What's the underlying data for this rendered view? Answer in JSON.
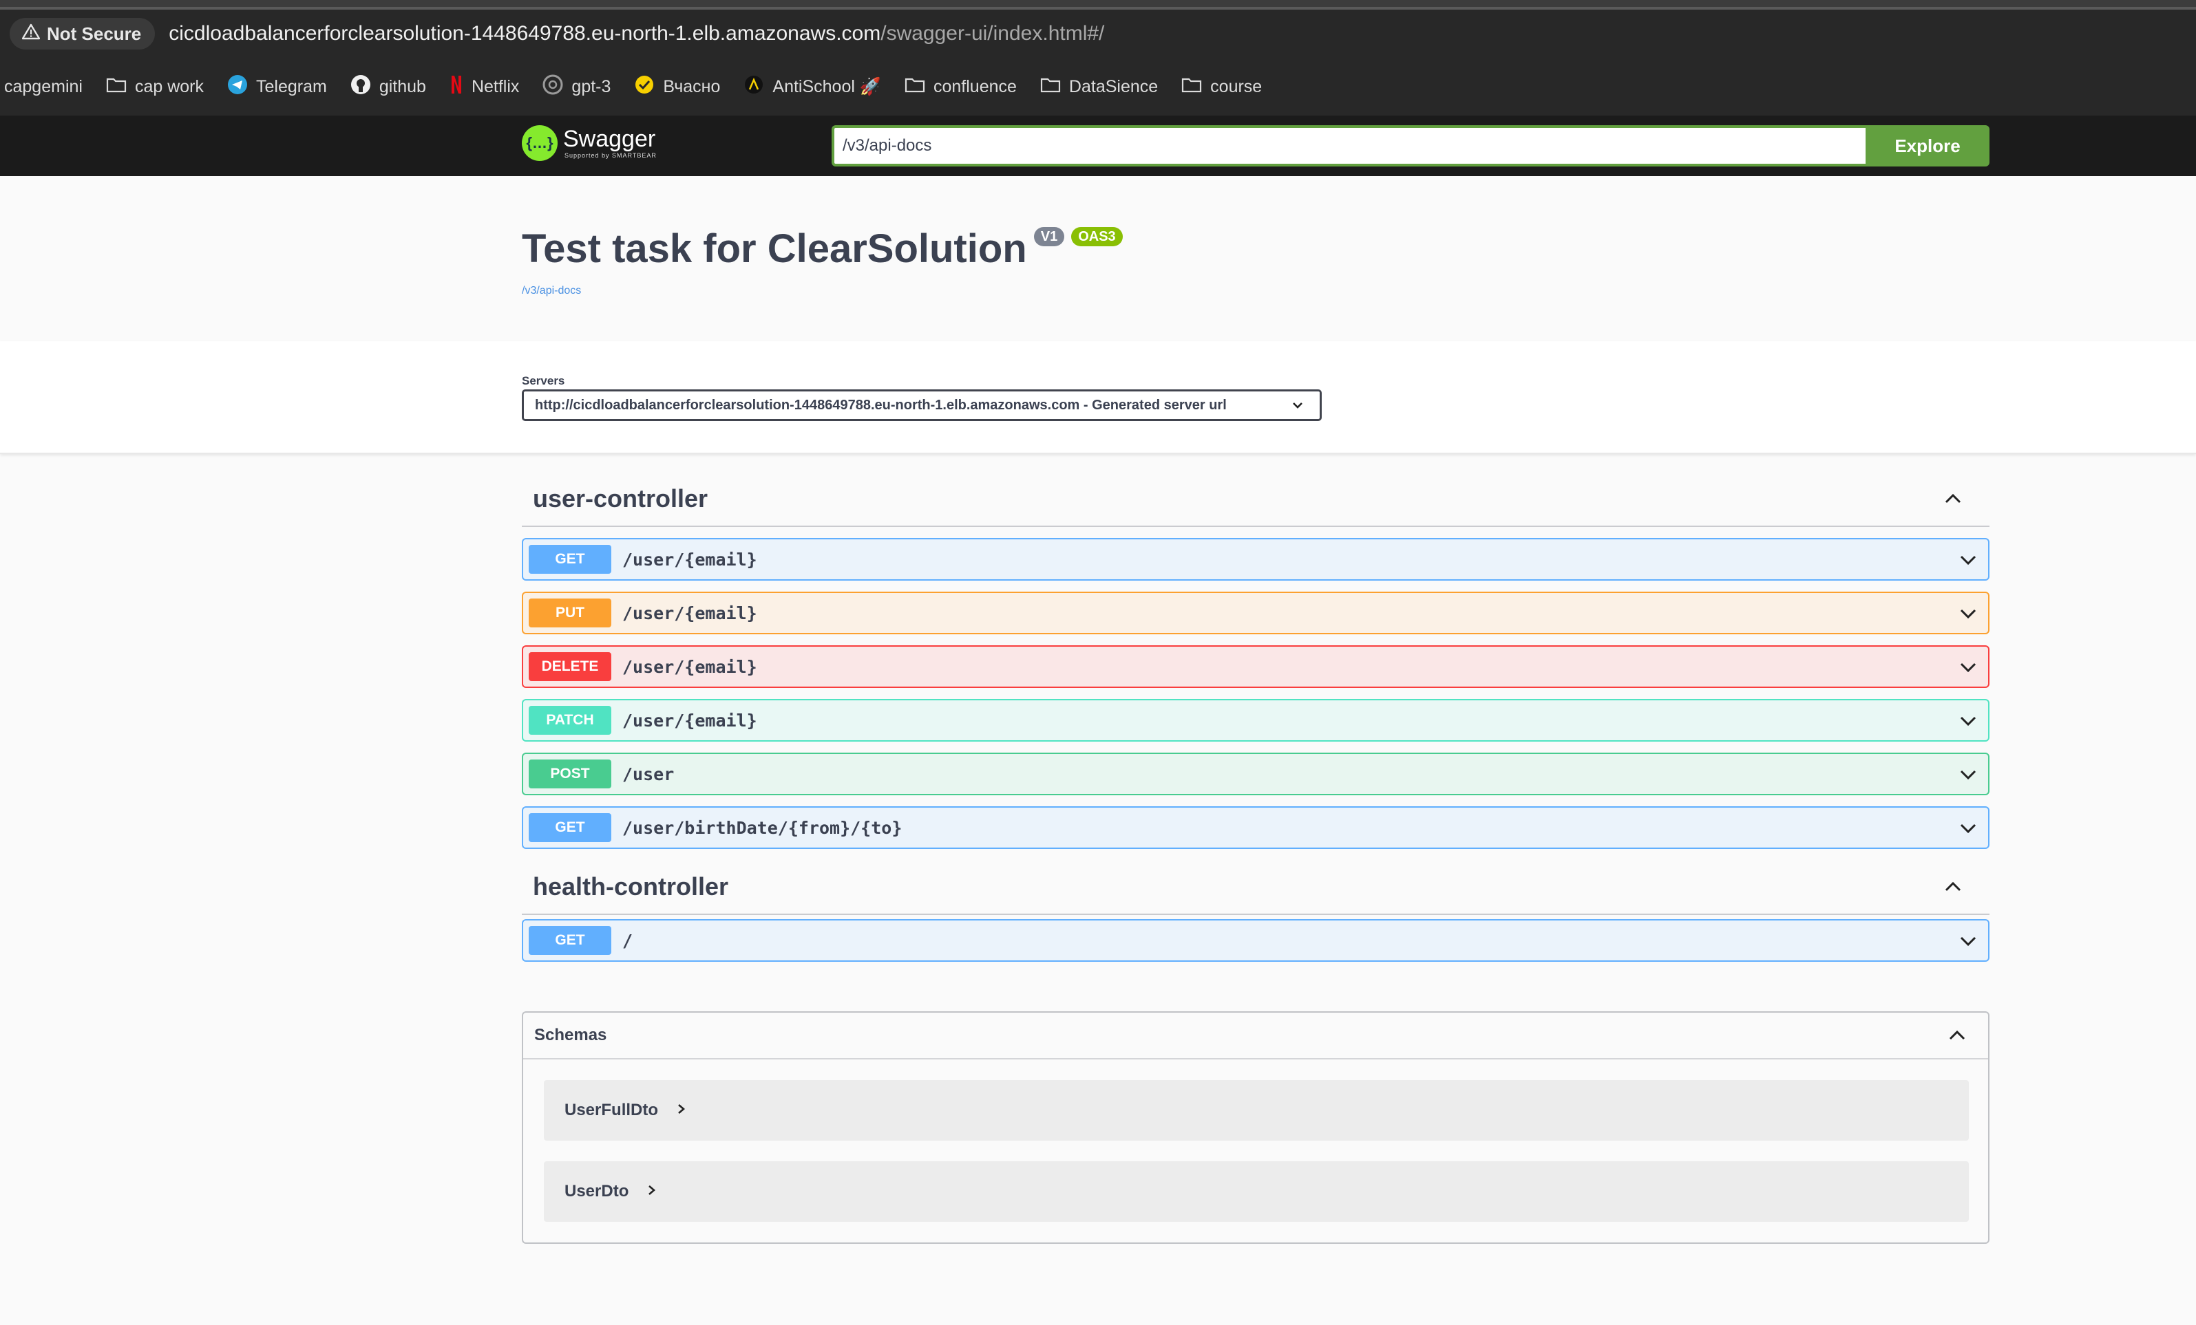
{
  "browser": {
    "not_secure_label": "Not Secure",
    "url_main": "cicdloadbalancerforclearsolution-1448649788.eu-north-1.elb.amazonaws.com",
    "url_path": "/swagger-ui/index.html#/",
    "bookmarks": [
      {
        "label": "capgemini",
        "icon": "none"
      },
      {
        "label": "cap work",
        "icon": "folder-icon"
      },
      {
        "label": "Telegram",
        "icon": "telegram-icon"
      },
      {
        "label": "github",
        "icon": "github-icon"
      },
      {
        "label": "Netflix",
        "icon": "netflix-icon"
      },
      {
        "label": "gpt-3",
        "icon": "openai-icon"
      },
      {
        "label": "Вчасно",
        "icon": "vchasno-icon"
      },
      {
        "label": "AntiSchool 🚀",
        "icon": "antischool-icon"
      },
      {
        "label": "confluence",
        "icon": "folder-icon"
      },
      {
        "label": "DataSience",
        "icon": "folder-icon"
      },
      {
        "label": "course",
        "icon": "folder-icon"
      }
    ]
  },
  "topbar": {
    "logo_text": "Swagger",
    "logo_sub": "Supported by SMARTBEAR",
    "spec_url": "/v3/api-docs",
    "explore_label": "Explore"
  },
  "info": {
    "title": "Test task for ClearSolution",
    "version": "V1",
    "oas": "OAS3",
    "spec_link": "/v3/api-docs"
  },
  "servers": {
    "label": "Servers",
    "selected": "http://cicdloadbalancerforclearsolution-1448649788.eu-north-1.elb.amazonaws.com - Generated server url"
  },
  "tags": [
    {
      "name": "user-controller",
      "operations": [
        {
          "method": "GET",
          "path": "/user/{email}"
        },
        {
          "method": "PUT",
          "path": "/user/{email}"
        },
        {
          "method": "DELETE",
          "path": "/user/{email}"
        },
        {
          "method": "PATCH",
          "path": "/user/{email}"
        },
        {
          "method": "POST",
          "path": "/user"
        },
        {
          "method": "GET",
          "path": "/user/birthDate/{from}/{to}"
        }
      ]
    },
    {
      "name": "health-controller",
      "operations": [
        {
          "method": "GET",
          "path": "/"
        }
      ]
    }
  ],
  "schemas": {
    "title": "Schemas",
    "models": [
      "UserFullDto",
      "UserDto"
    ]
  },
  "colors": {
    "get": "#61affe",
    "put": "#fca130",
    "delete": "#f93e3e",
    "patch": "#50e3c2",
    "post": "#49cc90",
    "explore": "#62a03f"
  }
}
